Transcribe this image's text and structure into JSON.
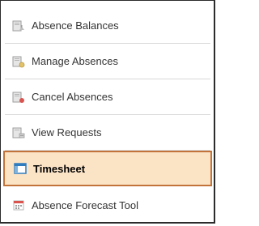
{
  "menu": {
    "items": [
      {
        "label": "Absence Balances",
        "icon": "absence-balances-icon",
        "selected": false
      },
      {
        "label": "Manage Absences",
        "icon": "manage-absences-icon",
        "selected": false
      },
      {
        "label": "Cancel Absences",
        "icon": "cancel-absences-icon",
        "selected": false
      },
      {
        "label": "View Requests",
        "icon": "view-requests-icon",
        "selected": false
      },
      {
        "label": "Timesheet",
        "icon": "timesheet-icon",
        "selected": true
      },
      {
        "label": "Absence Forecast Tool",
        "icon": "absence-forecast-tool-icon",
        "selected": false
      }
    ]
  },
  "colors": {
    "selected_background": "#fbe3c6",
    "selected_border": "#c2733a",
    "timesheet_icon_blue": "#2f7dbf",
    "forecast_icon_red": "#d9534f"
  }
}
